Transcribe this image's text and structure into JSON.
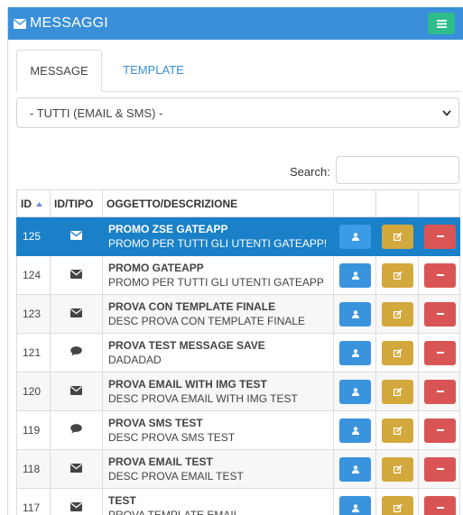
{
  "header": {
    "title": "MESSAGGI"
  },
  "tabs": [
    {
      "label": "MESSAGE",
      "active": true
    },
    {
      "label": "TEMPLATE",
      "active": false
    }
  ],
  "filter": {
    "selected": "- TUTTI (EMAIL & SMS) -"
  },
  "search": {
    "label": "Search:",
    "value": ""
  },
  "table": {
    "columns": {
      "id": "ID",
      "type": "ID/TIPO",
      "desc": "OGGETTO/DESCRIZIONE"
    },
    "rows": [
      {
        "id": "125",
        "type": "email",
        "title": "PROMO ZSE GATEAPP",
        "desc": "PROMO PER TUTTI GLI UTENTI GATEAPP!",
        "selected": true
      },
      {
        "id": "124",
        "type": "email",
        "title": "PROMO GATEAPP",
        "desc": "PROMO PER TUTTI GLI UTENTI GATEAPP",
        "selected": false
      },
      {
        "id": "123",
        "type": "email",
        "title": "PROVA CON TEMPLATE FINALE",
        "desc": "DESC PROVA CON TEMPLATE FINALE",
        "selected": false
      },
      {
        "id": "121",
        "type": "sms",
        "title": "PROVA TEST MESSAGE SAVE",
        "desc": "DADADAD",
        "selected": false
      },
      {
        "id": "120",
        "type": "email",
        "title": "PROVA EMAIL WITH IMG TEST",
        "desc": "DESC PROVA EMAIL WITH IMG TEST",
        "selected": false
      },
      {
        "id": "119",
        "type": "sms",
        "title": "PROVA SMS TEST",
        "desc": "DESC PROVA SMS TEST",
        "selected": false
      },
      {
        "id": "118",
        "type": "email",
        "title": "PROVA EMAIL TEST",
        "desc": "DESC PROVA EMAIL TEST",
        "selected": false
      },
      {
        "id": "117",
        "type": "email",
        "title": "TEST",
        "desc": "PROVA TEMPLATE EMAIL",
        "selected": false
      }
    ]
  },
  "colors": {
    "header": "#3a8fd9",
    "menu_button": "#2ebd8a",
    "selected_row": "#1a80c8",
    "view_button": "#3a93dd",
    "edit_button": "#d3a83c",
    "delete_button": "#d95555"
  },
  "icons": {
    "header": "envelope-icon",
    "menu": "bars-icon",
    "email_type": "envelope-icon",
    "sms_type": "comment-icon",
    "view": "user-icon",
    "edit": "edit-icon",
    "delete": "minus-icon",
    "sort": "sort-up-icon",
    "select": "chevron-down-icon"
  }
}
